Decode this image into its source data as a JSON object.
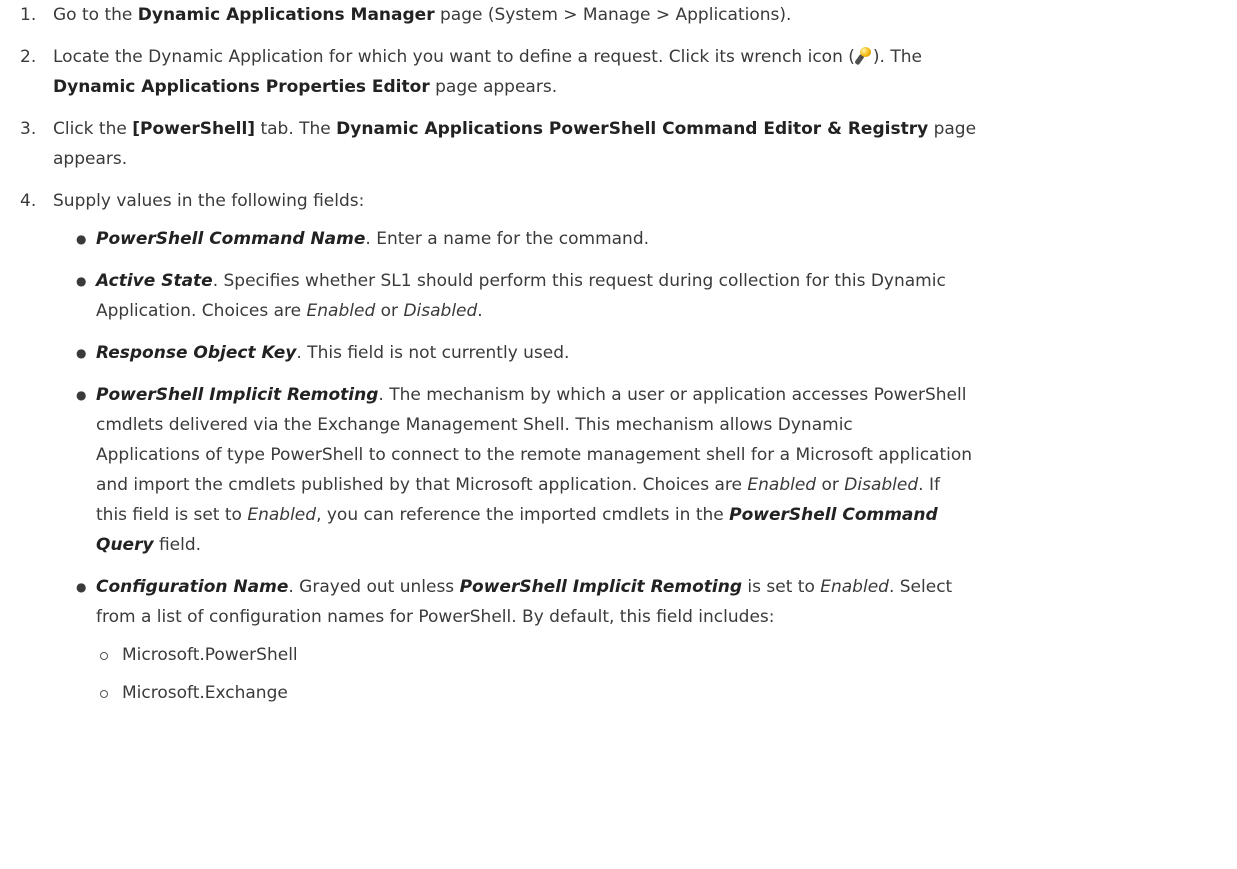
{
  "steps": [
    {
      "num": "1.",
      "t1": "Go to the ",
      "b1": "Dynamic Applications Manager",
      "t2": " page (System > Manage > Applications)."
    },
    {
      "num": "2.",
      "t1": "Locate the Dynamic Application for which you want to define a request. Click its wrench icon (",
      "icon": "wrench-icon",
      "t2": "). The",
      "b1": "Dynamic Applications Properties Editor",
      "t3": " page appears."
    },
    {
      "num": "3.",
      "t1": "Click the ",
      "b1": "[PowerShell]",
      "t2": " tab. The ",
      "b2": "Dynamic Applications PowerShell Command Editor & Registry",
      "t3": " page",
      "t4": "appears."
    },
    {
      "num": "4.",
      "t1": "Supply values in the following fields:"
    }
  ],
  "fields": [
    {
      "name": "PowerShell Command Name",
      "desc": ". Enter a name for the command."
    },
    {
      "name": "Active State",
      "desc1": ". Specifies whether SL1 should perform this request during collection for this Dynamic",
      "desc2": "Application. Choices are ",
      "opt1": "Enabled",
      "or": " or ",
      "opt2": "Disabled",
      "end": "."
    },
    {
      "name": "Response Object Key",
      "desc": ". This field is not currently used."
    },
    {
      "name": "PowerShell Implicit Remoting",
      "l1": ". The mechanism by which a user or application accesses PowerShell",
      "l2": "cmdlets delivered via the Exchange Management Shell. This mechanism allows Dynamic",
      "l3": "Applications of type PowerShell to connect to the remote management shell for a Microsoft application",
      "l4a": "and import the cmdlets published by that Microsoft application. Choices are ",
      "opt1": "Enabled",
      "or": " or ",
      "opt2": "Disabled",
      "l4b": ". If",
      "l5a": "this field is set to ",
      "opt3": "Enabled",
      "l5b": ", you can reference the imported cmdlets in the ",
      "ref1": "PowerShell Command",
      "ref2": "Query",
      "l6": " field."
    },
    {
      "name": "Configuration Name",
      "l1a": ". Grayed out unless ",
      "ref": "PowerShell Implicit Remoting",
      "l1b": " is set to ",
      "opt": "Enabled",
      "l1c": ". Select",
      "l2": "from a list of configuration names for PowerShell. By default, this field includes:",
      "items": [
        "Microsoft.PowerShell",
        "Microsoft.Exchange"
      ]
    }
  ]
}
